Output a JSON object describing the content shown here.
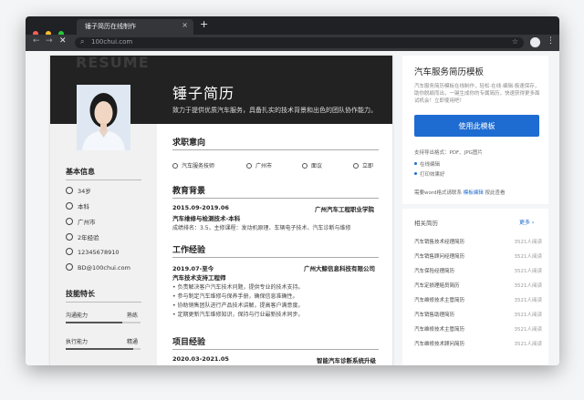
{
  "browser": {
    "tab_title": "锤子简历在线制作",
    "url": "100chui.com",
    "nav": {
      "back": "←",
      "forward": "→",
      "stop": "✕"
    }
  },
  "colors": {
    "accent": "#1e6cd1",
    "header_dark": "#222222",
    "mac_red": "#ff5f56",
    "mac_yellow": "#ffbd2e",
    "mac_green": "#27c93f"
  },
  "resume": {
    "watermark": "RESUME",
    "name": "锤子简历",
    "intro": "致力于提供优质汽车服务，具备扎实的技术背景和出色的团队协作能力。",
    "sidebar": {
      "basic_title": "基本信息",
      "info": [
        {
          "icon": "age-icon",
          "text": "34岁"
        },
        {
          "icon": "degree-icon",
          "text": "本科"
        },
        {
          "icon": "location-icon",
          "text": "广州市"
        },
        {
          "icon": "experience-icon",
          "text": "2年经验"
        },
        {
          "icon": "phone-icon",
          "text": "12345678910"
        },
        {
          "icon": "email-icon",
          "text": "BD@100chui.com"
        }
      ],
      "skills_title": "技能特长",
      "skills": [
        {
          "name": "沟通能力",
          "level": "熟练",
          "percent": 75
        },
        {
          "name": "执行能力",
          "level": "精通",
          "percent": 90
        },
        {
          "name": "写作能力",
          "level": "",
          "percent": 60
        }
      ]
    },
    "intent": {
      "title": "求职意向",
      "items": [
        {
          "icon": "job-icon",
          "text": "汽车服务技师"
        },
        {
          "icon": "city-icon",
          "text": "广州市"
        },
        {
          "icon": "salary-icon",
          "text": "面议"
        },
        {
          "icon": "status-icon",
          "text": "立即"
        }
      ]
    },
    "education": {
      "title": "教育背景",
      "date": "2015.09-2019.06",
      "school": "广州汽车工程职业学院",
      "major": "汽车维修与检测技术-本科",
      "detail": "成绩排名：3.5，主修课程：发动机原理、车辆电子技术、汽车诊断与维修"
    },
    "work": {
      "title": "工作经验",
      "date": "2019.07-至今",
      "company": "广州大鲸信息科技有限公司",
      "position": "汽车技术支持工程师",
      "bullets": [
        "• 负责解决客户汽车技术问题，提供专业的技术支持。",
        "• 参与制定汽车维修与保养手册，确保信息准确性。",
        "• 协助销售团队进行产品技术讲解，提高客户满意度。",
        "• 定期更新汽车维修知识，保持与行业最新技术同步。"
      ]
    },
    "project": {
      "title": "项目经验",
      "date": "2020.03-2021.05",
      "name": "智能汽车诊断系统升级"
    }
  },
  "panel": {
    "title": "汽车服务简历模板",
    "desc": "汽车服务简历模板在线制作，轻松·在线·编辑·极速保存，助你脱颖而出，一键生成你的专属简历，快速获得更多面试机会！立即使用吧！",
    "use_button": "使用此模板",
    "support": "支持导出格式：PDF、JPG图片",
    "bullets": [
      "在线编辑",
      "打印效果好"
    ],
    "word_text": "需要word格式请联系",
    "word_link": "模板编辑",
    "word_tail": "按此查看",
    "related_title": "相关简历",
    "related_more": "更多 ›",
    "related": [
      {
        "title": "汽车销售技术经理简历",
        "count": "3521人阅读"
      },
      {
        "title": "汽车销售顾问经理简历",
        "count": "3521人阅读"
      },
      {
        "title": "汽车保险经理简历",
        "count": "3521人阅读"
      },
      {
        "title": "汽车定损理赔员简历",
        "count": "3521人阅读"
      },
      {
        "title": "汽车维修技术主管简历",
        "count": "3521人阅读"
      },
      {
        "title": "汽车销售助理简历",
        "count": "3521人阅读"
      },
      {
        "title": "汽车维修技术主管简历",
        "count": "3521人阅读"
      },
      {
        "title": "汽车维修技术顾问简历",
        "count": "3521人阅读"
      }
    ]
  }
}
